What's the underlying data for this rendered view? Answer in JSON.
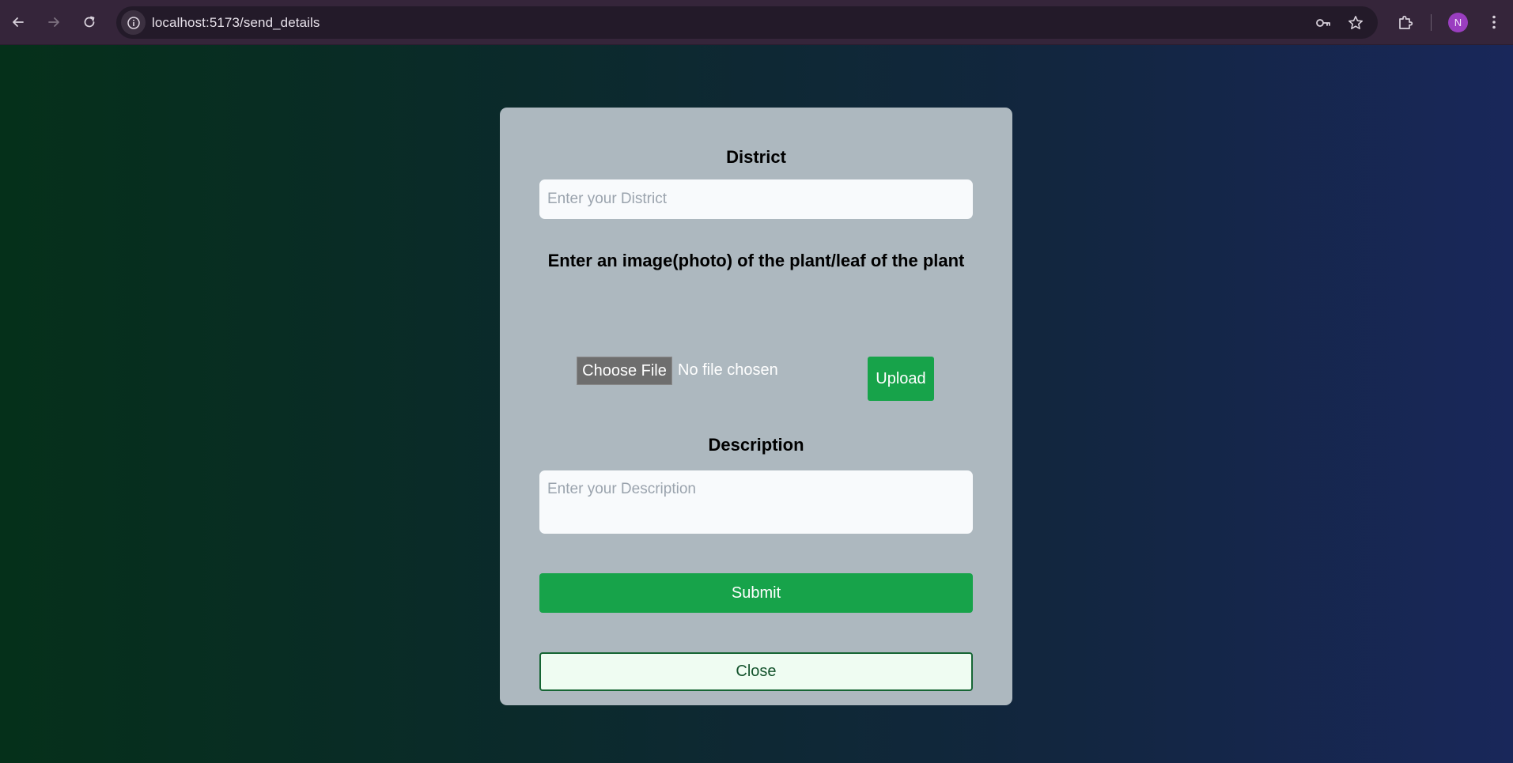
{
  "browser": {
    "url": "localhost:5173/send_details",
    "profile_initial": "N",
    "icons": {
      "back": "arrow-left-icon",
      "forward": "arrow-right-icon",
      "reload": "reload-icon",
      "site_info": "info-icon",
      "password": "key-icon",
      "bookmark": "star-icon",
      "extensions": "puzzle-icon",
      "menu": "kebab-menu-icon"
    },
    "colors": {
      "toolbar": "#35253a",
      "omnibox": "#231a29",
      "avatar": "#9a3ec0"
    }
  },
  "form": {
    "district_label": "District",
    "district_placeholder": "Enter your District",
    "image_label": "Enter an image(photo) of the plant/leaf of the plant",
    "choose_file_label": "Choose File",
    "no_file_text": "No file chosen",
    "upload_label": "Upload",
    "description_label": "Description",
    "description_placeholder": "Enter your Description",
    "submit_label": "Submit",
    "close_label": "Close",
    "colors": {
      "card": "#adb8bf",
      "primary": "#17a34a",
      "close_border": "#166534",
      "close_bg": "#effcf2"
    }
  }
}
